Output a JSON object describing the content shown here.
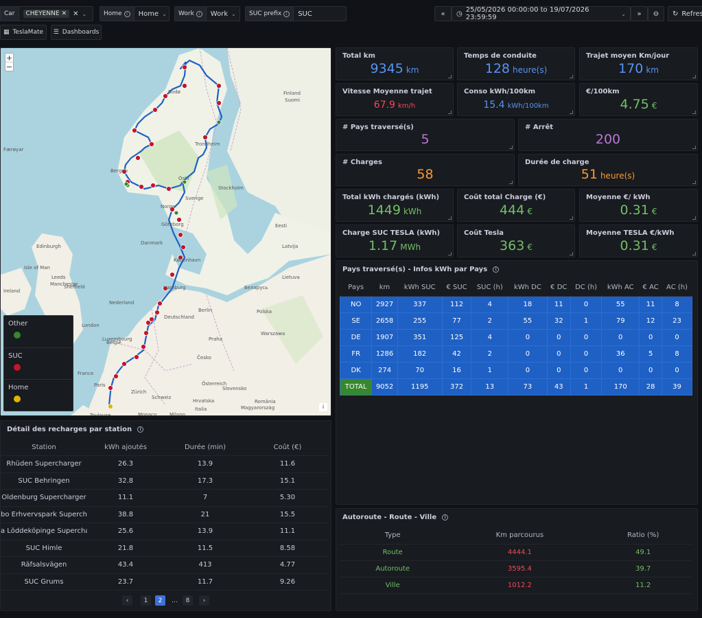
{
  "topbar": {
    "car": {
      "label": "Car",
      "value": "CHEYENNE"
    },
    "home": {
      "label": "Home",
      "value": "Home"
    },
    "work": {
      "label": "Work",
      "value": "Work"
    },
    "suc_prefix": {
      "label": "SUC prefix",
      "value": "SUC"
    },
    "time_range": "25/05/2026 00:00:00 to 19/07/2026 23:59:59",
    "refresh_label": "Refresh",
    "teslamate_link": "TeslaMate",
    "dashboards_link": "Dashboards"
  },
  "map": {
    "zoom_in": "+",
    "zoom_out": "−",
    "legend": [
      {
        "label": "Other",
        "color": "#37872d"
      },
      {
        "label": "SUC",
        "color": "#c4162a"
      },
      {
        "label": "Home",
        "color": "#e0b400"
      }
    ],
    "place_labels": [
      "Bodø",
      "Finland",
      "Suomi",
      "Trondheim",
      "Færøyar",
      "Norge",
      "Oslo",
      "Sverige",
      "Stockholm",
      "Bergen",
      "Eesti",
      "Latvija",
      "Danmark",
      "Göteborg",
      "Lietuva",
      "Edinburgh",
      "København",
      "Hamburg",
      "Беларусь",
      "Isle of Man",
      "Leeds",
      "Manchester",
      "Berlin",
      "Polska",
      "Ireland",
      "Sheffield",
      "Nederland",
      "Warszawa",
      "London",
      "Deutschland",
      "België",
      "Praha",
      "Česko",
      "Luxembourg",
      "Paris",
      "Slovensko",
      "Österreich",
      "Schweiz",
      "France",
      "Magyarország",
      "Zürich",
      "Milano",
      "Hrvatska",
      "România",
      "Toulouse",
      "Italia",
      "Monaco"
    ],
    "attribution": "i"
  },
  "stats": {
    "total_km": {
      "title": "Total km",
      "value": "9345",
      "unit": "km"
    },
    "temps_conduite": {
      "title": "Temps de conduite",
      "value": "128",
      "unit": "heure(s)"
    },
    "trajet_moyen": {
      "title": "Trajet moyen Km/jour",
      "value": "170",
      "unit": "km"
    },
    "vitesse_moyenne": {
      "title": "Vitesse Moyenne trajet",
      "value": "67.9",
      "unit": "km/h"
    },
    "conso": {
      "title": "Conso kWh/100km",
      "value": "15.4",
      "unit": "kWh/100km"
    },
    "eur_100km": {
      "title": "€/100km",
      "value": "4.75",
      "unit": "€"
    },
    "pays_traverses": {
      "title": "# Pays traversé(s)",
      "value": "5"
    },
    "arret": {
      "title": "# Arrêt",
      "value": "200"
    },
    "charges": {
      "title": "# Charges",
      "value": "58"
    },
    "duree_charge": {
      "title": "Durée de charge",
      "value": "51",
      "unit": "heure(s)"
    },
    "total_kwh": {
      "title": "Total kWh chargés (kWh)",
      "value": "1449",
      "unit": "kWh"
    },
    "cout_total": {
      "title": "Coût total Charge (€)",
      "value": "444",
      "unit": "€"
    },
    "moyenne_eur_kwh": {
      "title": "Moyenne €/ kWh",
      "value": "0.31",
      "unit": "€"
    },
    "charge_suc": {
      "title": "Charge SUC TESLA (kWh)",
      "value": "1.17",
      "unit": "MWh"
    },
    "cout_tesla": {
      "title": "Coût Tesla",
      "value": "363",
      "unit": "€"
    },
    "moyenne_tesla": {
      "title": "Moyenne TESLA €/kWh",
      "value": "0.31",
      "unit": "€"
    }
  },
  "pays_table": {
    "title": "Pays traversé(s) - Infos kWh par Pays",
    "columns": [
      "Pays",
      "km",
      "kWh SUC",
      "€ SUC",
      "SUC (h)",
      "kWh DC",
      "€ DC",
      "DC (h)",
      "kWh AC",
      "€ AC",
      "AC (h)"
    ],
    "rows": [
      [
        "NO",
        "2927",
        "337",
        "112",
        "4",
        "18",
        "11",
        "0",
        "55",
        "11",
        "8"
      ],
      [
        "SE",
        "2658",
        "255",
        "77",
        "2",
        "55",
        "32",
        "1",
        "79",
        "12",
        "23"
      ],
      [
        "DE",
        "1907",
        "351",
        "125",
        "4",
        "0",
        "0",
        "0",
        "0",
        "0",
        "0"
      ],
      [
        "FR",
        "1286",
        "182",
        "42",
        "2",
        "0",
        "0",
        "0",
        "36",
        "5",
        "8"
      ],
      [
        "DK",
        "274",
        "70",
        "16",
        "1",
        "0",
        "0",
        "0",
        "0",
        "0",
        "0"
      ],
      [
        "TOTAL",
        "9052",
        "1195",
        "372",
        "13",
        "73",
        "43",
        "1",
        "170",
        "28",
        "39"
      ]
    ]
  },
  "detail_table": {
    "title": "Détail des recharges par station",
    "columns": [
      "Station",
      "kWh ajoutés",
      "Durée (min)",
      "Coût (€)"
    ],
    "rows": [
      [
        "Rhüden Supercharger",
        "26.3",
        "13.9",
        "11.6"
      ],
      [
        "SUC Behringen",
        "32.8",
        "17.3",
        "15.1"
      ],
      [
        "Oldenburg Supercharger",
        "11.1",
        "7",
        "5.30"
      ],
      [
        "bo Erhvervspark Supercha",
        "38.8",
        "21",
        "15.5"
      ],
      [
        "a Löddeköpinge Supercha",
        "25.6",
        "13.9",
        "11.1"
      ],
      [
        "SUC Himle",
        "21.8",
        "11.5",
        "8.58"
      ],
      [
        "Räfsalsvägen",
        "43.4",
        "413",
        "4.77"
      ],
      [
        "SUC Grums",
        "23.7",
        "11.7",
        "9.26"
      ]
    ],
    "pagination": {
      "prev": "‹",
      "pages": [
        "1",
        "2",
        "…",
        "8"
      ],
      "active": "2",
      "next": "›"
    }
  },
  "route_table": {
    "title": "Autoroute - Route - Ville",
    "columns": [
      "Type",
      "Km parcourus",
      "Ratio (%)"
    ],
    "rows": [
      [
        "Route",
        "4444.1",
        "49.1"
      ],
      [
        "Autoroute",
        "3595.4",
        "39.7"
      ],
      [
        "Ville",
        "1012.2",
        "11.2"
      ]
    ]
  }
}
